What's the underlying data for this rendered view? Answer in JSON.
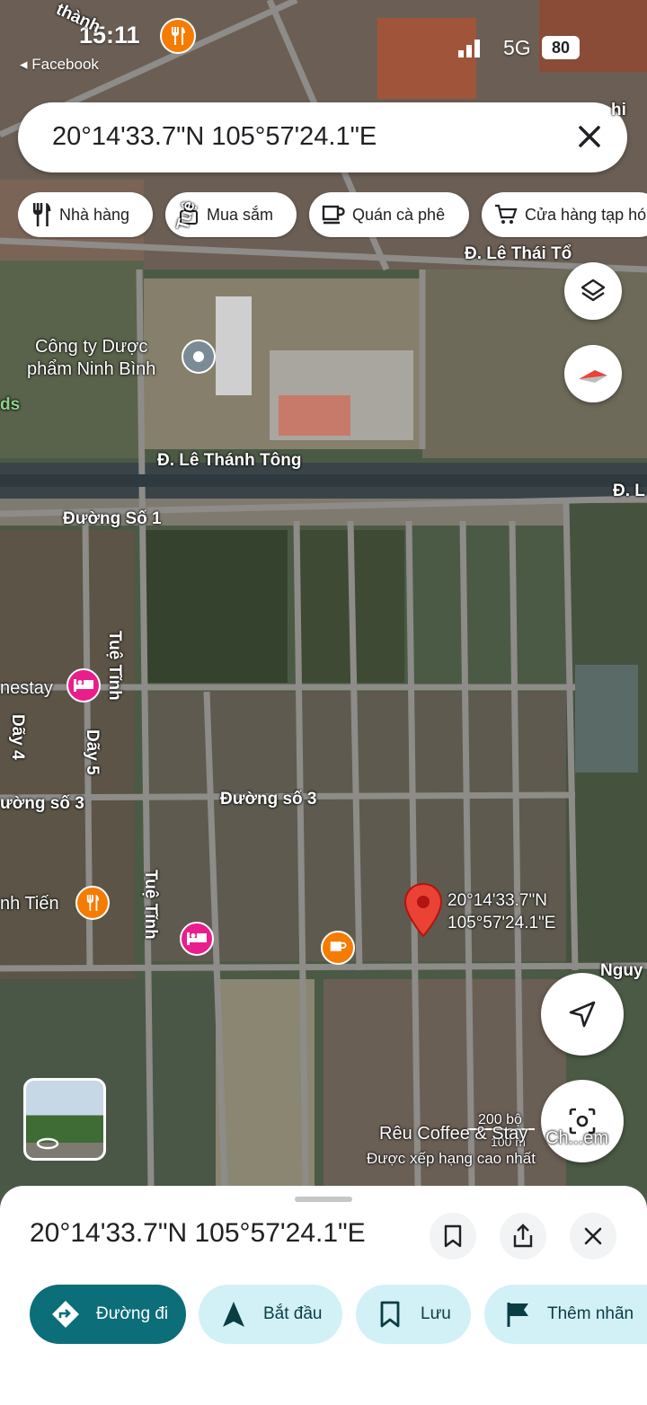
{
  "status_bar": {
    "time": "15:11",
    "back_app": "◂ Facebook",
    "network": "5G",
    "battery": "80"
  },
  "search": {
    "query": "20°14'33.7\"N 105°57'24.1\"E"
  },
  "chips": [
    {
      "label": "Nhà hàng",
      "icon": "restaurant-icon"
    },
    {
      "label": "Mua sắm",
      "icon": "shopping-bag-icon"
    },
    {
      "label": "Quán cà phê",
      "icon": "coffee-icon"
    },
    {
      "label": "Cửa hàng tạp hóa",
      "icon": "cart-icon"
    }
  ],
  "map": {
    "streets": [
      "Đ. Lê Thái Tổ",
      "Đ. Lê Thánh Tông",
      "Đ. L",
      "Đường Số 1",
      "Tuệ Tĩnh",
      "Dãy 4",
      "Dãy 5",
      "ường số 3",
      "Đường số 3",
      "Tuệ Tĩnh",
      "Nguy",
      "Tuệ",
      "thành",
      "hi"
    ],
    "poi_company": "Công ty Dược\nphẩm Ninh Bình",
    "poi_homestay": "nestay",
    "poi_restaurant": "nh Tiến",
    "poi_cafe": "Rêu Coffee & Stay",
    "poi_cafe_sub": "Được xếp hạng cao nhất",
    "pin_label": "20°14'33.7\"N\n105°57'24.1\"E",
    "scale_top": "200 bộ",
    "scale_bottom": "100 m",
    "left_edge": "ds",
    "streetview_label": "Ch...em"
  },
  "sheet": {
    "title": "20°14'33.7\"N 105°57'24.1\"E",
    "actions": [
      {
        "label": "Đường đi",
        "icon": "directions-icon"
      },
      {
        "label": "Bắt đầu",
        "icon": "navigation-arrow-icon"
      },
      {
        "label": "Lưu",
        "icon": "bookmark-icon"
      },
      {
        "label": "Thêm nhãn",
        "icon": "flag-icon"
      }
    ]
  },
  "colors": {
    "primary": "#0b6e78",
    "tonal": "#d2f1f7",
    "pin": "#ea4335",
    "food": "#f57c00",
    "lodging": "#e91e8c"
  }
}
